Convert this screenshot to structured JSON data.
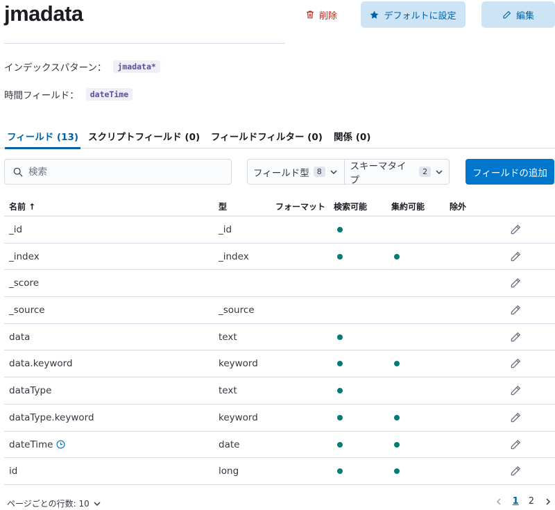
{
  "header": {
    "title": "jmadata",
    "delete_label": "削除",
    "default_label": "デフォルトに設定",
    "edit_label": "編集"
  },
  "meta": {
    "index_pattern_label": "インデックスパターン：",
    "index_pattern_value": "jmadata*",
    "time_field_label": "時間フィールド：",
    "time_field_value": "dateTime"
  },
  "tabs": [
    {
      "label": "フィールド (13)",
      "active": true
    },
    {
      "label": "スクリプトフィールド (0)",
      "active": false
    },
    {
      "label": "フィールドフィルター (0)",
      "active": false
    },
    {
      "label": "関係 (0)",
      "active": false
    }
  ],
  "toolbar": {
    "search_placeholder": "検索",
    "field_type_label": "フィールド型",
    "field_type_count": "8",
    "schema_type_label": "スキーマタイプ",
    "schema_type_count": "2",
    "add_field_label": "フィールドの追加"
  },
  "table": {
    "columns": {
      "name": "名前 ↑",
      "type": "型",
      "format": "フォーマット",
      "searchable": "検索可能",
      "aggregatable": "集約可能",
      "excluded": "除外"
    },
    "rows": [
      {
        "name": "_id",
        "type": "_id",
        "searchable": true,
        "aggregatable": false,
        "time": false
      },
      {
        "name": "_index",
        "type": "_index",
        "searchable": true,
        "aggregatable": true,
        "time": false
      },
      {
        "name": "_score",
        "type": "",
        "searchable": false,
        "aggregatable": false,
        "time": false
      },
      {
        "name": "_source",
        "type": "_source",
        "searchable": false,
        "aggregatable": false,
        "time": false
      },
      {
        "name": "data",
        "type": "text",
        "searchable": true,
        "aggregatable": false,
        "time": false
      },
      {
        "name": "data.keyword",
        "type": "keyword",
        "searchable": true,
        "aggregatable": true,
        "time": false
      },
      {
        "name": "dataType",
        "type": "text",
        "searchable": true,
        "aggregatable": false,
        "time": false
      },
      {
        "name": "dataType.keyword",
        "type": "keyword",
        "searchable": true,
        "aggregatable": true,
        "time": false
      },
      {
        "name": "dateTime",
        "type": "date",
        "searchable": true,
        "aggregatable": true,
        "time": true
      },
      {
        "name": "id",
        "type": "long",
        "searchable": true,
        "aggregatable": true,
        "time": false
      }
    ]
  },
  "footer": {
    "rows_per_page": "ページごとの行数: 10",
    "pages": [
      "1",
      "2"
    ],
    "current_page": "1"
  },
  "colors": {
    "accent": "#0077cc",
    "danger": "#bd271e",
    "dot": "#017d73",
    "soft_button": "#cce4f5"
  }
}
